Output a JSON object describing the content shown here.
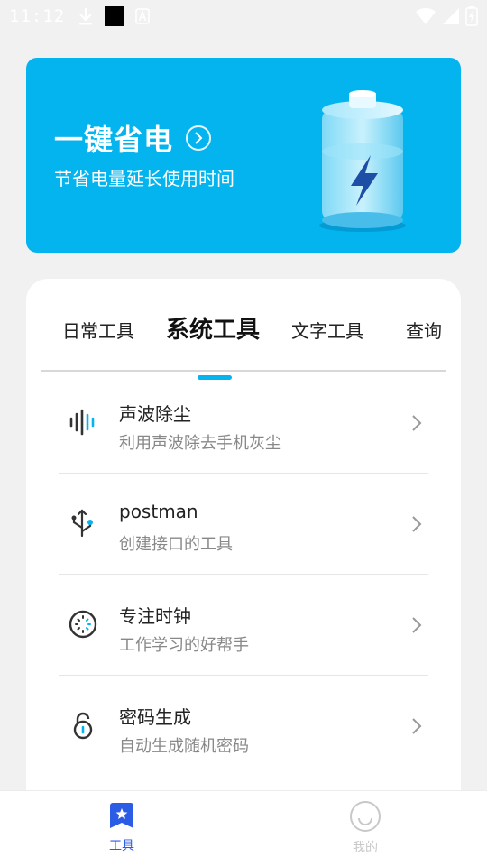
{
  "status_bar": {
    "time": "11:12"
  },
  "banner": {
    "title": "一键省电",
    "subtitle": "节省电量延长使用时间"
  },
  "tabs": [
    {
      "label": "日常工具",
      "active": false
    },
    {
      "label": "系统工具",
      "active": true
    },
    {
      "label": "文字工具",
      "active": false
    },
    {
      "label": "查询",
      "active": false
    }
  ],
  "tools": [
    {
      "title": "声波除尘",
      "desc": "利用声波除去手机灰尘",
      "icon": "sound-wave-icon"
    },
    {
      "title": "postman",
      "desc": "创建接口的工具",
      "icon": "usb-icon"
    },
    {
      "title": "专注时钟",
      "desc": "工作学习的好帮手",
      "icon": "focus-clock-icon"
    },
    {
      "title": "密码生成",
      "desc": "自动生成随机密码",
      "icon": "lock-icon"
    }
  ],
  "bottom_nav": {
    "tools_label": "工具",
    "mine_label": "我的"
  },
  "colors": {
    "accent": "#04b4ee",
    "nav_active": "#2b5ce6",
    "nav_inactive": "#c8c8c8"
  }
}
